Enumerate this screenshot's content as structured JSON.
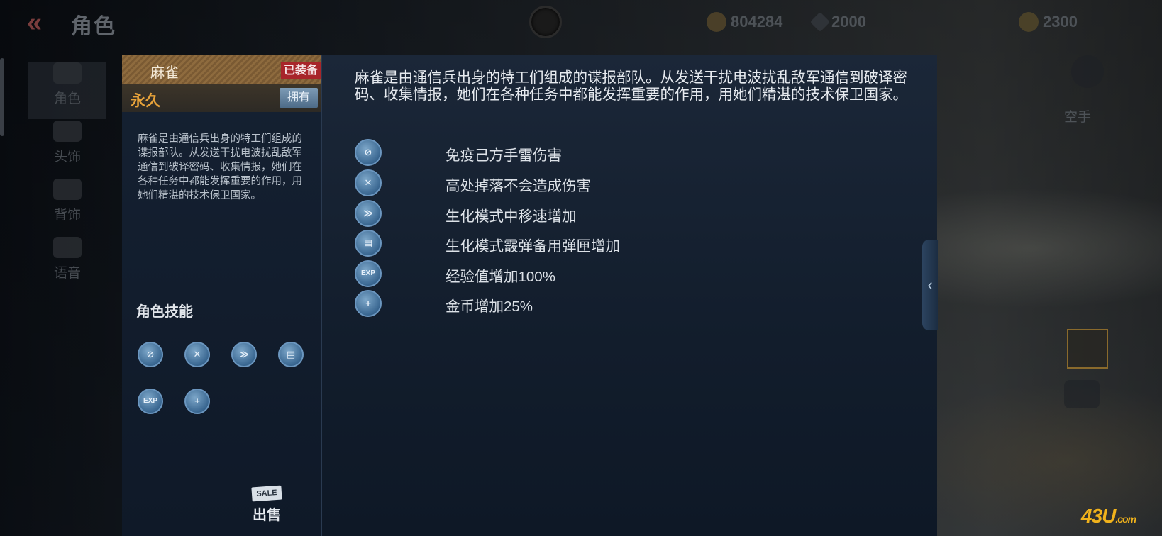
{
  "header": {
    "back_icon": "double-chevron-left-icon",
    "title": "角色",
    "currencies": [
      {
        "icon": "gold-bar-icon",
        "value": "804284"
      },
      {
        "icon": "diamond-icon",
        "value": "2000"
      },
      {
        "icon": "coin-icon",
        "value": "2300"
      }
    ]
  },
  "sidebar": {
    "items": [
      {
        "label": "角色",
        "icon": "mask-icon"
      },
      {
        "label": "头饰",
        "icon": "headgear-icon"
      },
      {
        "label": "背饰",
        "icon": "backpack-icon"
      },
      {
        "label": "语音",
        "icon": "voice-icon"
      }
    ]
  },
  "character": {
    "name": "麻雀",
    "equipped_badge": "已装备",
    "duration": "永久",
    "owned_label": "拥有",
    "description": "麻雀是由通信兵出身的特工们组成的谍报部队。从发送干扰电波扰乱敌军通信到破译密码、收集情报，她们在各种任务中都能发挥重要的作用，用她们精湛的技术保卫国家。",
    "skills_title": "角色技能",
    "sell_tag": "SALE",
    "sell_label": "出售"
  },
  "perks": [
    {
      "icon": "grenade-immune-icon",
      "glyph": "⊘",
      "text": "免疫己方手雷伤害"
    },
    {
      "icon": "fall-immune-icon",
      "glyph": "✕",
      "text": "高处掉落不会造成伤害"
    },
    {
      "icon": "run-speed-icon",
      "glyph": "≫",
      "text": "生化模式中移速增加"
    },
    {
      "icon": "ammo-clip-icon",
      "glyph": "▤",
      "text": "生化模式霰弹备用弹匣增加"
    },
    {
      "icon": "exp-icon",
      "glyph": "EXP",
      "text": "经验值增加100%"
    },
    {
      "icon": "coin-plus-icon",
      "glyph": "+",
      "text": "金币增加25%"
    }
  ],
  "right_hud": {
    "empty_hand": "空手"
  },
  "watermark": {
    "main": "43U",
    "suffix": ".com"
  }
}
